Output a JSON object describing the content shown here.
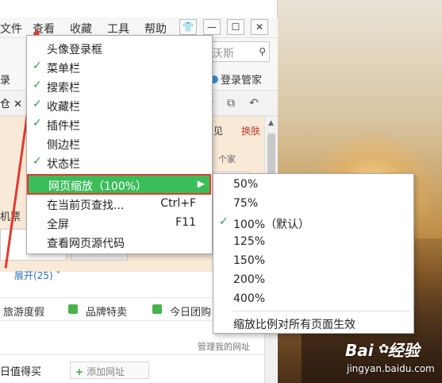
{
  "menubar": {
    "items": [
      "文件",
      "查看",
      "收藏",
      "工具",
      "帮助"
    ],
    "window_buttons": [
      "👕",
      "—",
      "☐",
      "✕"
    ]
  },
  "search": {
    "text": "沃斯",
    "icon": "search-icon"
  },
  "favbar": {
    "left_text": "录",
    "account": "登录管家"
  },
  "toolbar": {
    "left_text": "仓 ✕"
  },
  "page": {
    "tabs_text": "见",
    "skin": "换肤",
    "home_text": "个家",
    "flight": "机票",
    "expand": "展开(25)",
    "categories": [
      "旅游度假",
      "品牌特卖",
      "今日团购"
    ],
    "manage": "管理我的网址",
    "link": "日值得买",
    "add_site": "添加网址"
  },
  "view_menu": {
    "items": [
      {
        "label": "头像登录框",
        "checked": false
      },
      {
        "label": "菜单栏",
        "checked": true
      },
      {
        "label": "搜索栏",
        "checked": true
      },
      {
        "label": "收藏栏",
        "checked": true
      },
      {
        "label": "插件栏",
        "checked": true
      },
      {
        "label": "侧边栏",
        "checked": false
      },
      {
        "label": "状态栏",
        "checked": true
      }
    ],
    "zoom": "网页缩放（100%）",
    "find": {
      "label": "在当前页查找...",
      "shortcut": "Ctrl+F"
    },
    "fullscreen": {
      "label": "全屏",
      "shortcut": "F11"
    },
    "source": "查看网页源代码"
  },
  "zoom_menu": {
    "options": [
      "50%",
      "75%",
      "100%（默认）",
      "125%",
      "150%",
      "200%",
      "400%"
    ],
    "selected_index": 2,
    "apply_all": "缩放比例对所有页面生效"
  },
  "watermark": {
    "logo": "Bai",
    "logo2": "经验",
    "url": "jingyan.baidu.com"
  },
  "colors": {
    "highlight": "#3bbd5a",
    "annotation": "#e23a2f",
    "check": "#2e9b48"
  }
}
